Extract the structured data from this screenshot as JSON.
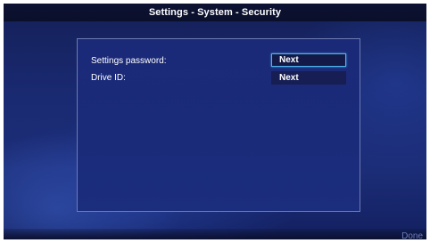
{
  "header": {
    "title": "Settings - System - Security"
  },
  "security": {
    "rows": [
      {
        "label": "Settings password:",
        "button_label": "Next"
      },
      {
        "label": "Drive ID:",
        "button_label": "Next"
      }
    ]
  },
  "footer": {
    "done_label": "Done"
  },
  "colors": {
    "focus_accent": "#4fb4ec",
    "background": "#1a2a72"
  }
}
